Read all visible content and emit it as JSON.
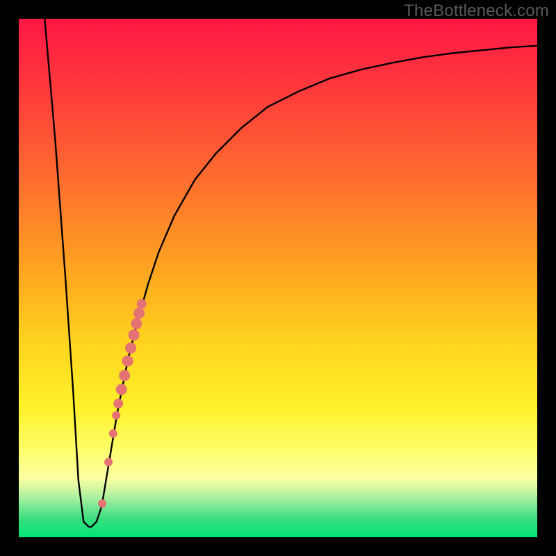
{
  "watermark": "TheBottleneck.com",
  "colors": {
    "frame": "#000000",
    "curve": "#000000",
    "markers": "#e57373",
    "gradient_stops": [
      {
        "pos": 0.0,
        "color": "#ff1744"
      },
      {
        "pos": 0.14,
        "color": "#ff3b3b"
      },
      {
        "pos": 0.3,
        "color": "#ff6a2f"
      },
      {
        "pos": 0.48,
        "color": "#ffa321"
      },
      {
        "pos": 0.62,
        "color": "#ffd21f"
      },
      {
        "pos": 0.75,
        "color": "#fff22a"
      },
      {
        "pos": 0.83,
        "color": "#fdfe69"
      },
      {
        "pos": 0.885,
        "color": "#fcffa0"
      },
      {
        "pos": 0.905,
        "color": "#d7f7a2"
      },
      {
        "pos": 0.925,
        "color": "#a5efa0"
      },
      {
        "pos": 0.945,
        "color": "#6ee78f"
      },
      {
        "pos": 0.965,
        "color": "#38de7e"
      },
      {
        "pos": 1.0,
        "color": "#00e676"
      }
    ]
  },
  "chart_data": {
    "type": "line",
    "title": "",
    "xlabel": "",
    "ylabel": "",
    "xlim": [
      0,
      100
    ],
    "ylim": [
      0,
      100
    ],
    "series": [
      {
        "name": "bottleneck-curve",
        "x": [
          5,
          7,
          9,
          10.5,
          11.5,
          12.5,
          13.5,
          14,
          15,
          16,
          17,
          19,
          21,
          23,
          25,
          27,
          30,
          34,
          38,
          43,
          48,
          54,
          60,
          66,
          72,
          78,
          84,
          90,
          95,
          100
        ],
        "y": [
          100,
          77,
          50,
          28,
          11,
          3,
          2,
          2,
          3,
          6,
          12,
          24,
          34,
          42,
          49,
          55,
          62,
          69,
          74,
          79,
          83,
          86,
          88.5,
          90.2,
          91.5,
          92.6,
          93.4,
          94.0,
          94.5,
          94.8
        ]
      }
    ],
    "markers": {
      "name": "highlight-points",
      "points": [
        {
          "x": 16.1,
          "y": 6.5,
          "r": 6
        },
        {
          "x": 17.3,
          "y": 14.5,
          "r": 6
        },
        {
          "x": 18.2,
          "y": 20.0,
          "r": 6
        },
        {
          "x": 18.8,
          "y": 23.5,
          "r": 6
        },
        {
          "x": 19.2,
          "y": 25.8,
          "r": 7
        },
        {
          "x": 19.8,
          "y": 28.5,
          "r": 8
        },
        {
          "x": 20.4,
          "y": 31.2,
          "r": 8
        },
        {
          "x": 21.0,
          "y": 34.0,
          "r": 8
        },
        {
          "x": 21.6,
          "y": 36.5,
          "r": 8
        },
        {
          "x": 22.2,
          "y": 39.0,
          "r": 8
        },
        {
          "x": 22.7,
          "y": 41.2,
          "r": 8
        },
        {
          "x": 23.2,
          "y": 43.2,
          "r": 8
        },
        {
          "x": 23.7,
          "y": 45.0,
          "r": 7
        }
      ]
    }
  }
}
